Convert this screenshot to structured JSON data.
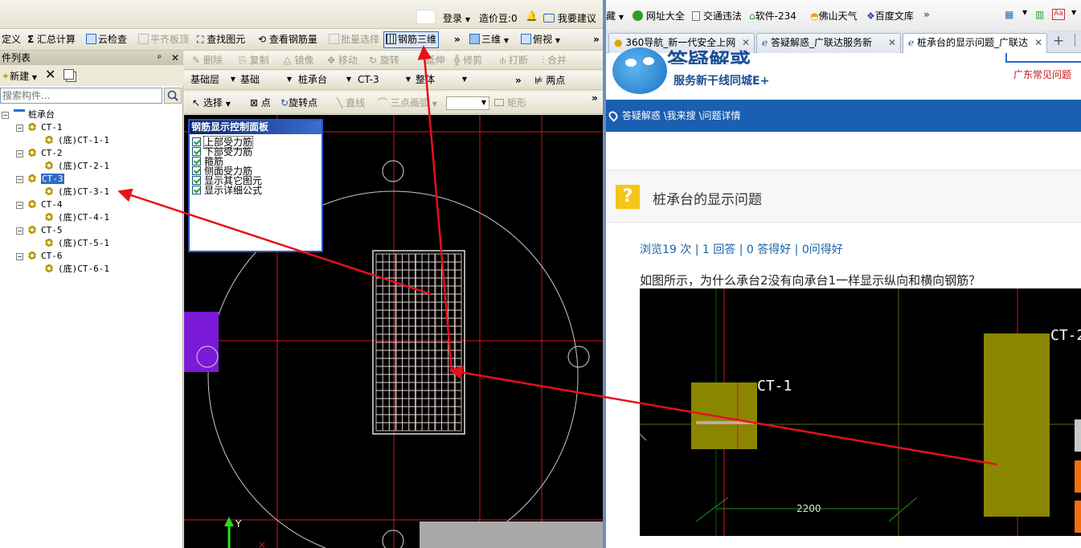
{
  "left_app": {
    "login_strip": {
      "login": "登录",
      "credit": "造价豆:0",
      "suggest": "我要建议"
    },
    "toolbar1": {
      "define": "定义",
      "sum_calc": "汇总计算",
      "cloud_check": "云检查",
      "align_slab": "平齐板顶",
      "find_element": "查找图元",
      "view_rebar_qty": "查看钢筋量",
      "batch_select": "批量选择",
      "rebar_3d": "钢筋三维",
      "more1": "»",
      "three_d": "三维",
      "top_view": "俯视",
      "more2": "»"
    },
    "component_panel": {
      "title": "件列表",
      "pin": "ᵖ",
      "close": "✕",
      "new_label": "新建",
      "search_placeholder": "搜索构件...",
      "tree": {
        "root": "桩承台",
        "nodes": [
          {
            "name": "CT-1",
            "child": "(底)CT-1-1"
          },
          {
            "name": "CT-2",
            "child": "(底)CT-2-1"
          },
          {
            "name": "CT-3",
            "child": "(底)CT-3-1"
          },
          {
            "name": "CT-4",
            "child": "(底)CT-4-1"
          },
          {
            "name": "CT-5",
            "child": "(底)CT-5-1"
          },
          {
            "name": "CT-6",
            "child": "(底)CT-6-1"
          }
        ]
      }
    },
    "draw_toolbar1": {
      "delete": "删除",
      "copy": "复制",
      "mirror": "镜像",
      "move": "移动",
      "rotate": "旋转",
      "extend": "延伸",
      "trim": "修剪",
      "break": "打断",
      "merge": "合并"
    },
    "draw_toolbar2": {
      "layer": "基础层",
      "category": "基础",
      "type": "桩承台",
      "component": "CT-3",
      "unit": "整体",
      "more": "»",
      "two_points": "两点"
    },
    "draw_toolbar3": {
      "select": "选择",
      "point": "点",
      "rotate_point": "旋转点",
      "line": "直线",
      "three_point_arc": "三点画弧",
      "rect": "矩形",
      "more": "»"
    },
    "rebar_panel": {
      "title": "钢筋显示控制面板",
      "options": [
        {
          "label": "上部受力筋",
          "checked": true
        },
        {
          "label": "下部受力筋",
          "checked": true
        },
        {
          "label": "箍筋",
          "checked": true
        },
        {
          "label": "侧面受力筋",
          "checked": true
        },
        {
          "label": "显示其它图元",
          "checked": true
        },
        {
          "label": "显示详细公式",
          "checked": true
        }
      ]
    },
    "axis_y_label": "Y"
  },
  "browser": {
    "bookmarks": {
      "fav_tail": "藏",
      "site_nav": "网址大全",
      "traffic": "交通违法",
      "software": "软件-234",
      "weather": "佛山天气",
      "wenku": "百度文库",
      "more": "»"
    },
    "tabs": [
      {
        "label": "360导航_新一代安全上网",
        "active": false
      },
      {
        "label": "答疑解惑_广联达服务新",
        "active": false
      },
      {
        "label": "桩承台的显示问题_广联达",
        "active": true
      }
    ],
    "new_tab": "+",
    "header": {
      "brand": "答疑解惑",
      "slogan": "服务新干线同城E+",
      "faq_link": "广东常见问题"
    },
    "breadcrumb": "答疑解惑 \\我来搜 \\问题详情",
    "question": {
      "mark": "?",
      "title": "桩承台的显示问题",
      "stats": "浏览19 次 | 1 回答 | 0 答得好 | 0问得好",
      "body": "如图所示，为什么承台2没有向承台1一样显示纵向和横向钢筋？",
      "image_labels": {
        "ct1": "CT-1",
        "ct2": "CT-2",
        "dimension": "2200"
      }
    }
  },
  "colors": {
    "annotation_arrow": "#e8101c",
    "cad_red_line": "#d01818",
    "purple_block": "#7a1ad6",
    "olive_block": "#8a8600",
    "browser_nav_blue": "#1a5fb0",
    "selection_blue": "#316ac5"
  }
}
